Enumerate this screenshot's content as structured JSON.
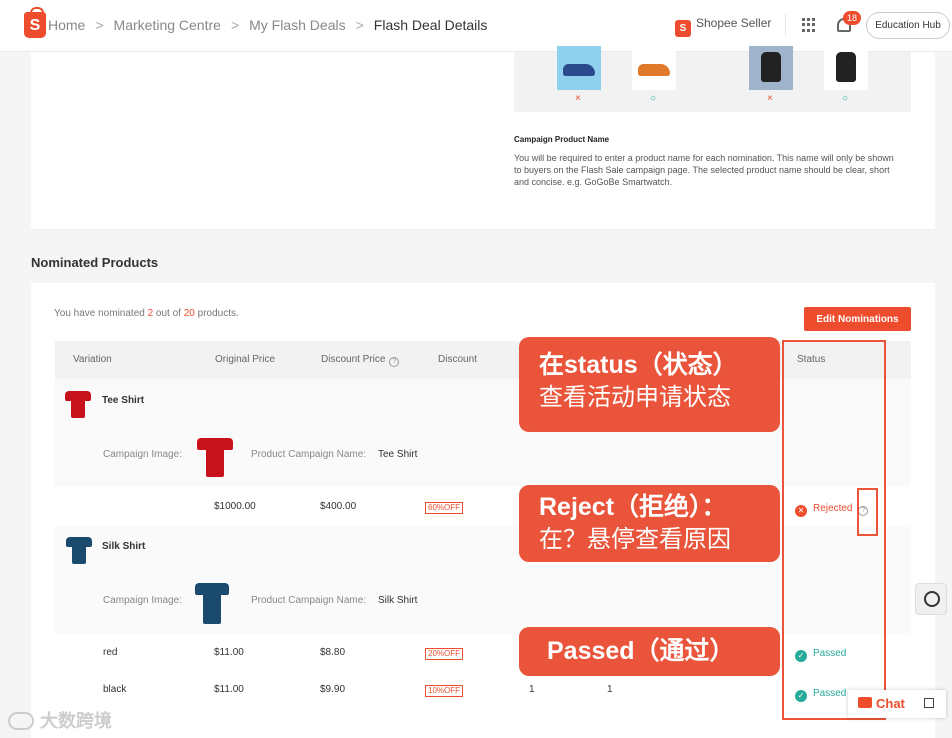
{
  "header": {
    "breadcrumbs": [
      "Home",
      "Marketing Centre",
      "My Flash Deals",
      "Flash Deal Details"
    ],
    "seller_label": "Shopee Seller",
    "notification_count": "18",
    "education_hub": "Education Hub"
  },
  "samples": {
    "marks": [
      "×",
      "○",
      "×",
      "○"
    ],
    "campaign_name_title": "Campaign Product Name",
    "campaign_name_desc": "You will be required to enter a product name for each nomination. This name will only be shown to buyers on the Flash Sale campaign page. The selected product name should be clear, short and concise. e.g. GoGoBe Smartwatch."
  },
  "nominated": {
    "section_title": "Nominated Products",
    "count_prefix": "You have nominated ",
    "count_done": "2",
    "count_mid": " out of ",
    "count_total": "20",
    "count_suffix": " products.",
    "edit_button": "Edit Nominations",
    "columns": [
      "Variation",
      "Original Price",
      "Discount Price",
      "Discount",
      "Status"
    ],
    "help_glyph": "?",
    "campaign_image_label": "Campaign Image:",
    "campaign_name_label": "Product Campaign Name:",
    "products": [
      {
        "name": "Tee Shirt",
        "campaign_name": "Tee Shirt",
        "color": "#c8121b",
        "rows": [
          {
            "variation": "",
            "original_price": "$1000.00",
            "discount_price": "$400.00",
            "discount": "60%OFF",
            "status": "Rejected"
          }
        ]
      },
      {
        "name": "Silk Shirt",
        "campaign_name": "Silk Shirt",
        "color": "#1a4a6e",
        "rows": [
          {
            "variation": "red",
            "original_price": "$11.00",
            "discount_price": "$8.80",
            "discount": "20%OFF",
            "status": "Passed"
          },
          {
            "variation": "black",
            "original_price": "$11.00",
            "discount_price": "$9.90",
            "discount": "10%OFF",
            "col5": "1",
            "col6": "1",
            "status": "Passed"
          }
        ]
      }
    ]
  },
  "callouts": {
    "status_l1": "在status（状态）",
    "status_l2": "查看活动申请状态",
    "reject_l1": "Reject（拒绝）：",
    "reject_l2": "在？悬停查看原因",
    "passed_l1": "Passed（通过）"
  },
  "chat_label": "Chat",
  "watermark": "大数跨境",
  "colors": {
    "brand": "#ee4d2d",
    "passed": "#26aa99",
    "callout": "#e9543a"
  }
}
